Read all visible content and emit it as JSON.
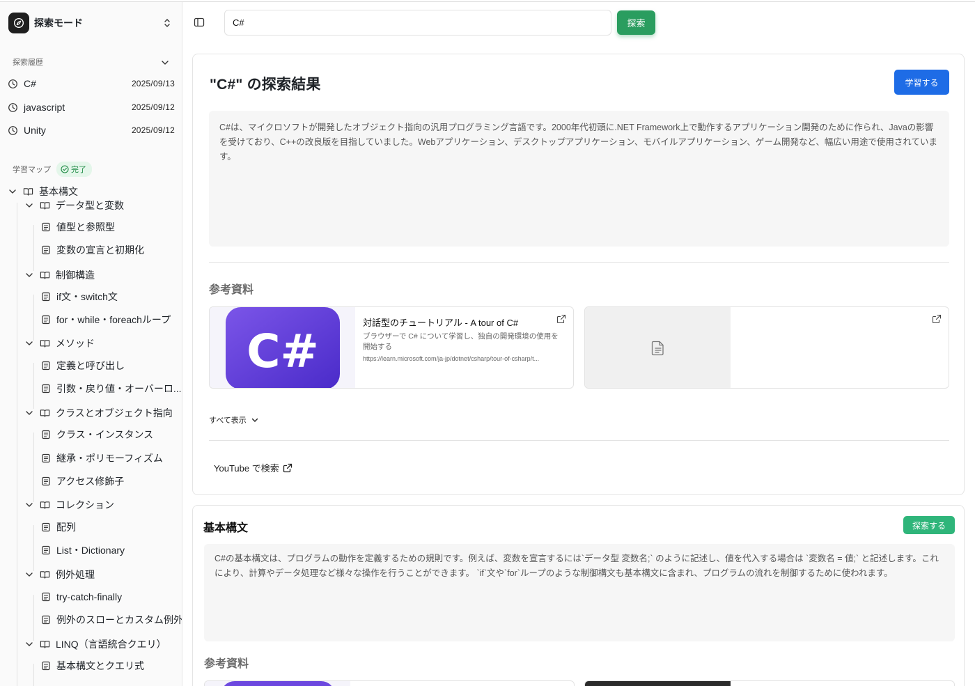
{
  "mode": {
    "label": "探索モード"
  },
  "history": {
    "heading": "探索履歴",
    "items": [
      {
        "label": "C#",
        "date": "2025/09/13"
      },
      {
        "label": "javascript",
        "date": "2025/09/12"
      },
      {
        "label": "Unity",
        "date": "2025/09/12"
      }
    ]
  },
  "map": {
    "heading": "学習マップ",
    "badge": "完了",
    "root": "基本構文",
    "nodes": [
      "データ型と変数",
      "値型と参照型",
      "変数の宣言と初期化",
      "制御構造",
      "if文・switch文",
      "for・while・foreachループ",
      "メソッド",
      "定義と呼び出し",
      "引数・戻り値・オーバーロ...",
      "クラスとオブジェクト指向",
      "クラス・インスタンス",
      "継承・ポリモーフィズム",
      "アクセス修飾子",
      "コレクション",
      "配列",
      "List・Dictionary",
      "例外処理",
      "try-catch-finally",
      "例外のスローとカスタム例外",
      "LINQ（言語統合クエリ）",
      "基本構文とクエリ式"
    ]
  },
  "search": {
    "value": "C#",
    "button": "探索"
  },
  "result": {
    "title": "\"C#\" の探索結果",
    "learn_button": "学習する",
    "summary": "C#は、マイクロソフトが開発したオブジェクト指向の汎用プログラミング言語です。2000年代初頭に.NET Framework上で動作するアプリケーション開発のために作られ、Javaの影響を受けており、C++の改良版を目指していました。Webアプリケーション、デスクトップアプリケーション、モバイルアプリケーション、ゲーム開発など、幅広い用途で使用されています。",
    "references_heading": "参考資料",
    "references": [
      {
        "title": "対話型のチュートリアル - A tour of C#",
        "description": "ブラウザーで C# について学習し、独自の開発環境の使用を開始する",
        "url": "https://learn.microsoft.com/ja-jp/dotnet/csharp/tour-of-csharp/t...",
        "thumb_text": "C#"
      },
      {
        "title": "",
        "description": "",
        "url": ""
      }
    ],
    "show_all": "すべて表示",
    "youtube": "YouTube で検索"
  },
  "section2": {
    "title": "基本構文",
    "explore_button": "探索する",
    "summary": "C#の基本構文は、プログラムの動作を定義するための規則です。例えば、変数を宣言するには`データ型 変数名;` のように記述し、値を代入する場合は `変数名 = 値;` と記述します。これにより、計算やデータ処理など様々な操作を行うことができます。 `if`文や`for`ループのような制御構文も基本構文に含まれ、プログラムの流れを制御するために使われます。",
    "references_heading": "参考資料"
  },
  "colors": {
    "primary_green": "#2a9d5f",
    "primary_blue": "#1e6ce6",
    "badge_green": "#1e8a44",
    "thumb_purple": "#5b3bd6"
  }
}
